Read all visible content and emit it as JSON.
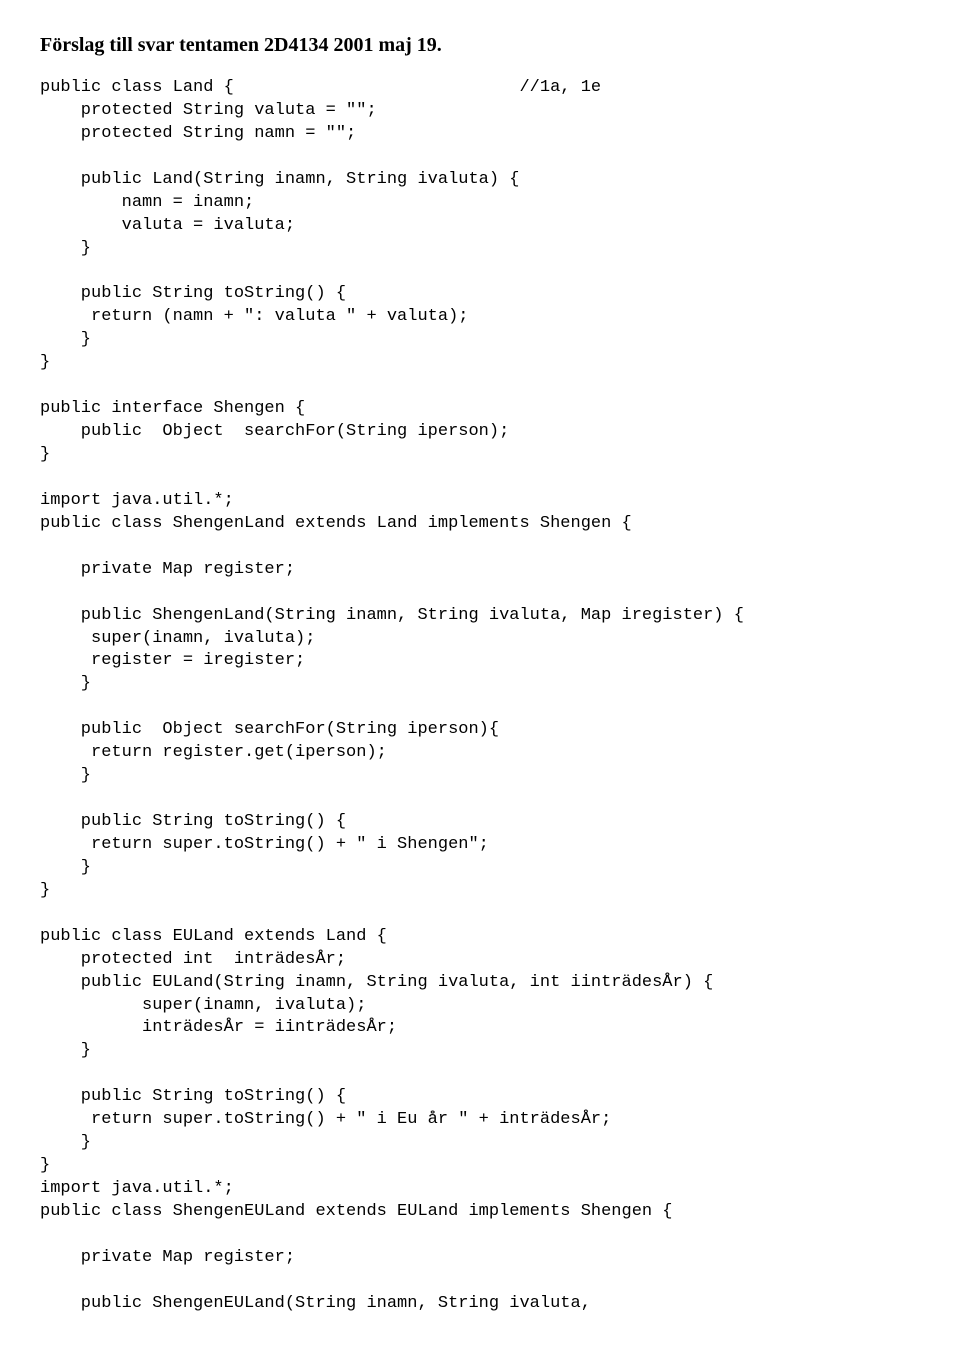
{
  "title": "Förslag till svar tentamen 2D4134 2001 maj 19.",
  "code": "public class Land {                            //1a, 1e\n    protected String valuta = \"\";\n    protected String namn = \"\";\n\n    public Land(String inamn, String ivaluta) {\n        namn = inamn;\n        valuta = ivaluta;\n    }\n\n    public String toString() {\n     return (namn + \": valuta \" + valuta);\n    }\n}\n\npublic interface Shengen {\n    public  Object  searchFor(String iperson);\n}\n\nimport java.util.*;\npublic class ShengenLand extends Land implements Shengen {\n\n    private Map register;\n\n    public ShengenLand(String inamn, String ivaluta, Map iregister) {\n     super(inamn, ivaluta);\n     register = iregister;\n    }\n\n    public  Object searchFor(String iperson){\n     return register.get(iperson);\n    }\n\n    public String toString() {\n     return super.toString() + \" i Shengen\";\n    }\n}\n\npublic class EULand extends Land {\n    protected int  inträdesÅr;\n    public EULand(String inamn, String ivaluta, int iinträdesÅr) {\n          super(inamn, ivaluta);\n          inträdesÅr = iinträdesÅr;\n    }\n\n    public String toString() {\n     return super.toString() + \" i Eu år \" + inträdesÅr;\n    }\n}\nimport java.util.*;\npublic class ShengenEULand extends EULand implements Shengen {\n\n    private Map register;\n\n    public ShengenEULand(String inamn, String ivaluta,"
}
